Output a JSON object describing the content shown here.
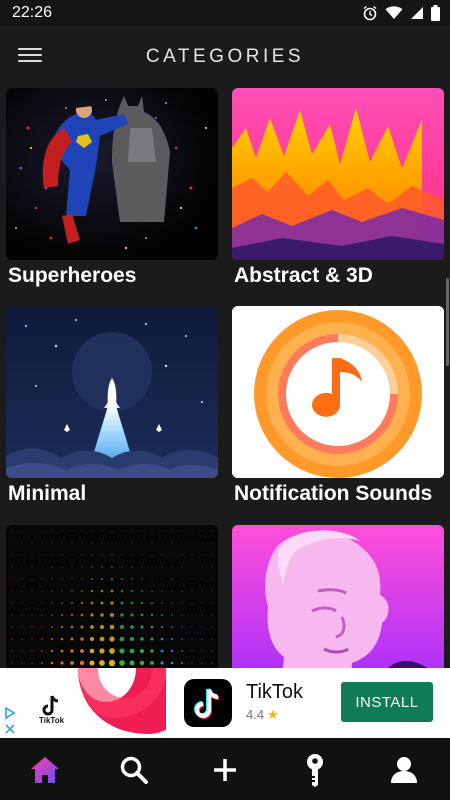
{
  "status_bar": {
    "time": "22:26",
    "icons": [
      "alarm-icon",
      "wifi-icon",
      "signal-icon",
      "battery-icon"
    ]
  },
  "header": {
    "title": "CATEGORIES",
    "menu_icon": "hamburger-menu-icon"
  },
  "categories": [
    {
      "label": "Superheroes"
    },
    {
      "label": "Abstract & 3D"
    },
    {
      "label": "Minimal"
    },
    {
      "label": "Notification Sounds"
    },
    {
      "label": ""
    },
    {
      "label": ""
    }
  ],
  "ad": {
    "visual_caption": "TikTok",
    "app_name": "TikTok",
    "rating": "4.4",
    "install_label": "INSTALL"
  },
  "bottom_nav": {
    "items": [
      "home-icon",
      "search-icon",
      "add-icon",
      "key-icon",
      "profile-icon"
    ],
    "active": "home-icon",
    "active_color": "#7a4dff"
  },
  "colors": {
    "background": "#1b1b1b",
    "install": "#107c57",
    "accent_orange": "#ff6d12"
  }
}
